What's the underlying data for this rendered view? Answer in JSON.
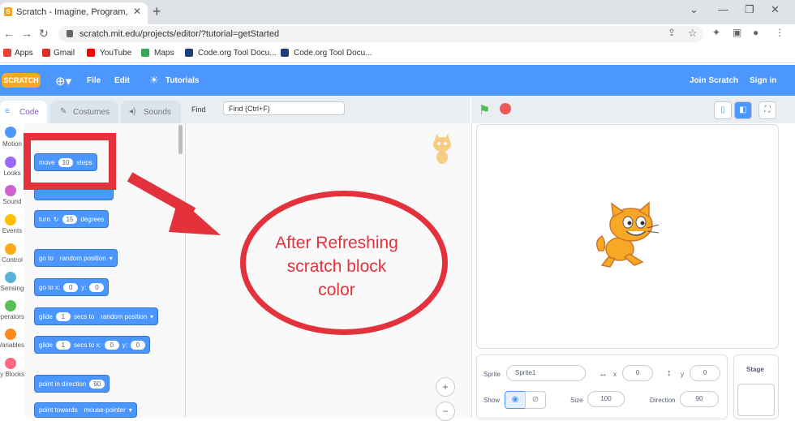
{
  "browser": {
    "tab_title": "Scratch - Imagine, Program, Sha",
    "url": "scratch.mit.edu/projects/editor/?tutorial=getStarted",
    "bookmarks": [
      {
        "label": "Apps",
        "color": "#e94235"
      },
      {
        "label": "Gmail",
        "color": "#d93025"
      },
      {
        "label": "YouTube",
        "color": "#ff0000"
      },
      {
        "label": "Maps",
        "color": "#34a853"
      },
      {
        "label": "Code.org Tool Docu...",
        "color": "#1f3f7a"
      },
      {
        "label": "Code.org Tool Docu...",
        "color": "#1f3f7a"
      }
    ]
  },
  "menubar": {
    "logo": "SCRATCH",
    "file": "File",
    "edit": "Edit",
    "tutorials": "Tutorials",
    "join": "Join Scratch",
    "signin": "Sign in"
  },
  "editor_tabs": {
    "code": "Code",
    "costumes": "Costumes",
    "sounds": "Sounds"
  },
  "find": {
    "label": "Find",
    "placeholder": "Find (Ctrl+F)"
  },
  "categories": [
    {
      "label": "Motion",
      "color": "#4c97ff"
    },
    {
      "label": "Looks",
      "color": "#9966ff"
    },
    {
      "label": "Sound",
      "color": "#cf63cf"
    },
    {
      "label": "Events",
      "color": "#ffbf00"
    },
    {
      "label": "Control",
      "color": "#ffab19"
    },
    {
      "label": "Sensing",
      "color": "#5cb1d6"
    },
    {
      "label": "Operators",
      "color": "#59c059"
    },
    {
      "label": "Variables",
      "color": "#ff8c1a"
    },
    {
      "label": "My Blocks",
      "color": "#ff6680"
    }
  ],
  "blocks": {
    "move": {
      "pre": "move",
      "val": "10",
      "post": "steps"
    },
    "turn": {
      "pre": "turn",
      "val": "15",
      "post": "degrees"
    },
    "goto": {
      "pre": "go to",
      "val": "random position"
    },
    "gotoxy": {
      "pre": "go to x:",
      "x": "0",
      "ylbl": "y:",
      "y": "0"
    },
    "glide1": {
      "pre": "glide",
      "val": "1",
      "mid": "secs to",
      "dd": "random position"
    },
    "glide2": {
      "pre": "glide",
      "val": "1",
      "mid": "secs to x:",
      "x": "0",
      "ylbl": "y:",
      "y": "0"
    },
    "point": {
      "pre": "point in direction",
      "val": "90"
    },
    "towards": {
      "pre": "point towards",
      "val": "mouse-pointer"
    }
  },
  "annotation": {
    "line1": "After Refreshing",
    "line2": "scratch block",
    "line3": "color",
    "color": "#e4323c"
  },
  "sprite_info": {
    "sprite_label": "Sprite",
    "sprite_name": "Sprite1",
    "x_label": "x",
    "x": "0",
    "y_label": "y",
    "y": "0",
    "show_label": "Show",
    "size_label": "Size",
    "size": "100",
    "direction_label": "Direction",
    "direction": "90"
  },
  "stage_panel": {
    "label": "Stage"
  }
}
